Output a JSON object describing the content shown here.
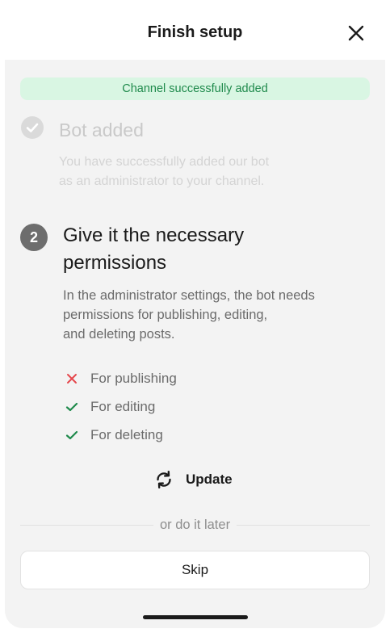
{
  "header": {
    "title": "Finish setup",
    "close_icon": "close-icon"
  },
  "banner": {
    "text": "Channel successfully added",
    "color": "#1f8a4c",
    "background": "#d9f6e3"
  },
  "step1": {
    "icon": "check-circle-icon",
    "title": "Bot added",
    "description": "You have successfully added our bot\nas an administrator to your channel."
  },
  "step2": {
    "number": "2",
    "title": "Give it the necessary\npermissions",
    "description": "In the administrator settings, the bot needs\npermissions for publishing, editing,\nand deleting posts."
  },
  "permissions": [
    {
      "label": "For publishing",
      "status": "missing",
      "icon": "cross-icon",
      "color": "#e5484d"
    },
    {
      "label": "For editing",
      "status": "granted",
      "icon": "check-icon",
      "color": "#1f8a4c"
    },
    {
      "label": "For deleting",
      "status": "granted",
      "icon": "check-icon",
      "color": "#1f8a4c"
    }
  ],
  "update_button": {
    "label": "Update",
    "icon": "refresh-icon"
  },
  "divider_text": "or do it later",
  "skip_button": {
    "label": "Skip"
  }
}
